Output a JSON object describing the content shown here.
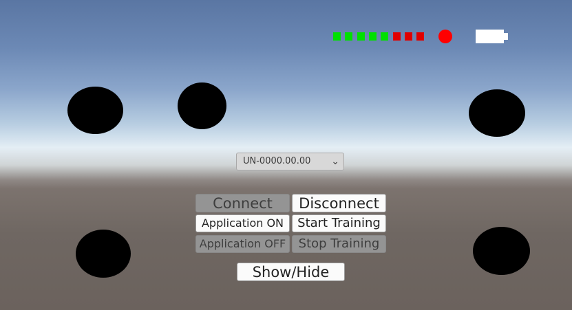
{
  "status": {
    "signal_bars": [
      "#00e000",
      "#00e000",
      "#00e000",
      "#00e000",
      "#00e000",
      "#e00000",
      "#e00000",
      "#e00000"
    ],
    "record_indicator_color": "#ff0000",
    "battery_color": "#ffffff"
  },
  "device_selector": {
    "value": "UN-0000.00.00"
  },
  "buttons": {
    "connect": "Connect",
    "disconnect": "Disconnect",
    "application_on": "Application ON",
    "start_training": "Start Training",
    "application_off": "Application OFF",
    "stop_training": "Stop Training",
    "show_hide": "Show/Hide"
  }
}
